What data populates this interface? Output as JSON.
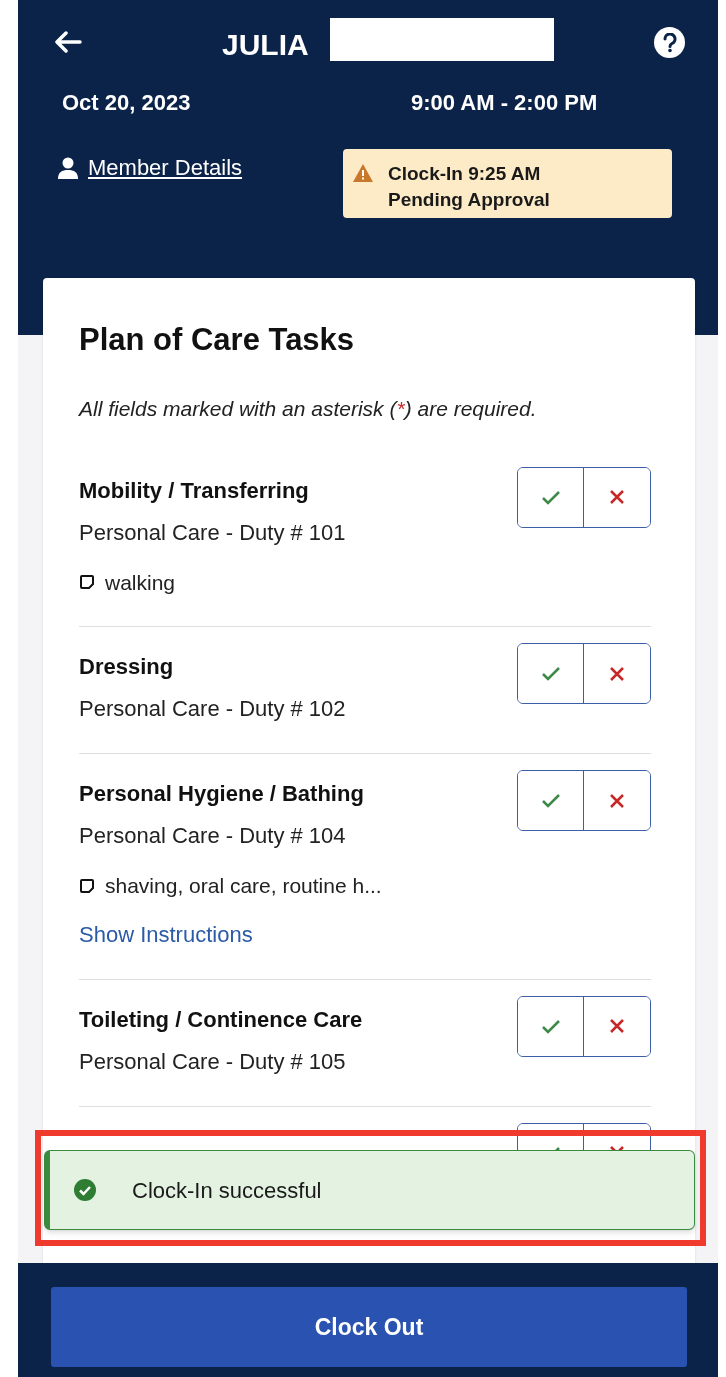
{
  "header": {
    "title": "JULIA",
    "redacted": true,
    "date": "Oct 20, 2023",
    "time_range": "9:00 AM - 2:00 PM",
    "member_link": "Member Details",
    "status_badge": {
      "kind": "warning",
      "lines": [
        "Clock-In 9:25 AM",
        "Pending Approval"
      ]
    }
  },
  "card": {
    "title": "Plan of Care Tasks",
    "note_before": "All fields marked with an asterisk (",
    "asterisk": "*",
    "note_after": ") are required.",
    "tasks": [
      {
        "title": "Mobility / Transferring",
        "subtitle": "Personal Care - Duty # 101",
        "note": "walking",
        "completed": false,
        "not_completed": false
      },
      {
        "title": "Dressing",
        "subtitle": "Personal Care - Duty # 102",
        "completed": false,
        "not_completed": false
      },
      {
        "title": "Personal Hygiene / Bathing",
        "subtitle": "Personal Care - Duty # 104",
        "note": "shaving, oral care, routine h...",
        "link": "Show Instructions",
        "completed": false,
        "not_completed": false
      },
      {
        "title": "Toileting / Continence Care",
        "subtitle": "Personal Care - Duty # 105",
        "completed": false,
        "not_completed": false
      },
      {
        "completed": false,
        "not_completed": false
      }
    ]
  },
  "toast": {
    "kind": "success",
    "message": "Clock-In successful",
    "highlighted": true
  },
  "footer": {
    "button": "Clock Out"
  }
}
